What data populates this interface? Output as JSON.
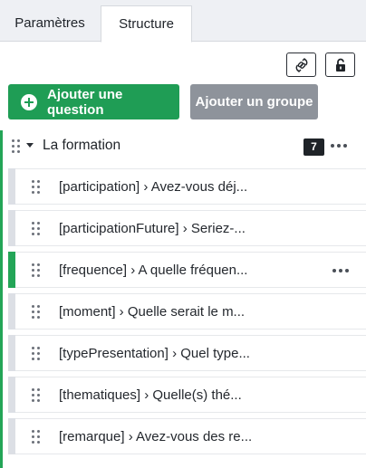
{
  "tabs": [
    {
      "label": "Paramètres",
      "active": false
    },
    {
      "label": "Structure",
      "active": true
    }
  ],
  "toolbar": {
    "icons": [
      "link-refresh-icon",
      "unlock-icon"
    ]
  },
  "actions": {
    "add_question": "Ajouter une question",
    "add_group": "Ajouter un groupe"
  },
  "group": {
    "title": "La formation",
    "count": "7"
  },
  "questions": [
    {
      "label": "[participation] › Avez-vous déj..."
    },
    {
      "label": "[participationFuture] › Seriez-..."
    },
    {
      "label": "[frequence] › A quelle fréquen...",
      "selected": true
    },
    {
      "label": "[moment] › Quelle serait le m..."
    },
    {
      "label": "[typePresentation] › Quel type..."
    },
    {
      "label": "[thematiques] › Quelle(s) thé..."
    },
    {
      "label": "[remarque] › Avez-vous des re..."
    }
  ],
  "colors": {
    "accent": "#1f9d55",
    "selected_bar": "#23a557",
    "disabled_button": "#8e939b"
  }
}
